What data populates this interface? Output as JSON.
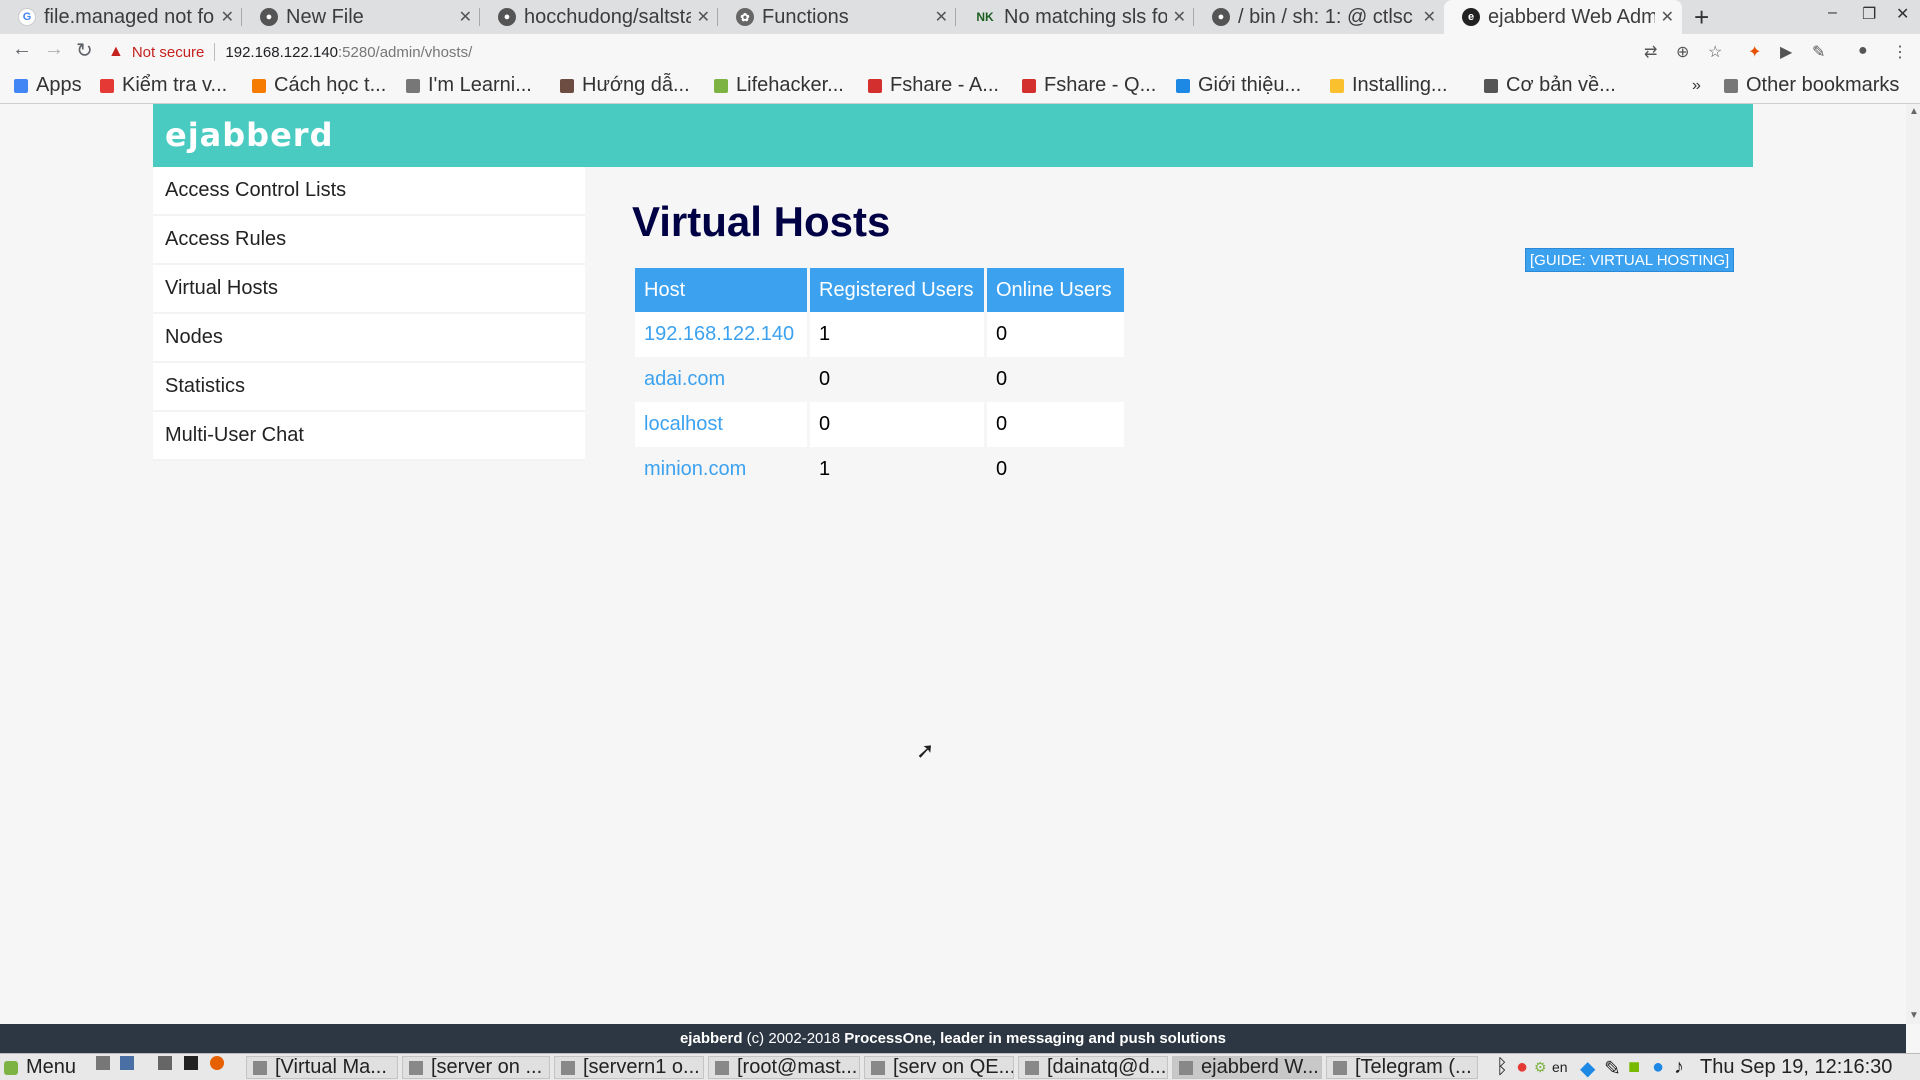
{
  "browser": {
    "tabs": [
      {
        "title": "file.managed not fo",
        "icon": "google-icon"
      },
      {
        "title": "New File",
        "icon": "github-icon"
      },
      {
        "title": "hocchudong/saltsta",
        "icon": "github-icon"
      },
      {
        "title": "Functions",
        "icon": "salt-icon"
      },
      {
        "title": "No matching sls fou",
        "icon": "nk-icon",
        "fav_text": "NK"
      },
      {
        "title": "/ bin / sh: 1: @ ctlsc",
        "icon": "github-icon"
      },
      {
        "title": "ejabberd Web Adm",
        "icon": "ejabberd-icon",
        "active": true
      }
    ],
    "address": {
      "security": "Not secure",
      "host": "192.168.122.140",
      "path": ":5280/admin/vhosts/"
    },
    "bookmarks": [
      {
        "label": "Apps",
        "color": "#4285f4"
      },
      {
        "label": "Kiểm tra v...",
        "color": "#e53935"
      },
      {
        "label": "Cách học t...",
        "color": "#f57c00"
      },
      {
        "label": "I'm Learni...",
        "color": "#777777"
      },
      {
        "label": "Hướng dẫ...",
        "color": "#6d4c41"
      },
      {
        "label": "Lifehacker...",
        "color": "#7cb342"
      },
      {
        "label": "Fshare - A...",
        "color": "#d32f2f"
      },
      {
        "label": "Fshare - Q...",
        "color": "#d32f2f"
      },
      {
        "label": "Giới thiệu...",
        "color": "#1e88e5"
      },
      {
        "label": "Installing...",
        "color": "#fbc02d"
      },
      {
        "label": "Cơ bản về...",
        "color": "#555555"
      }
    ],
    "bookmarks_more": "»",
    "other_bookmarks": "Other bookmarks"
  },
  "page": {
    "logo": "ejabberd",
    "sidebar": [
      "Access Control Lists",
      "Access Rules",
      "Virtual Hosts",
      "Nodes",
      "Statistics",
      "Multi-User Chat"
    ],
    "title": "Virtual Hosts",
    "guide_button": "[GUIDE: VIRTUAL HOSTING]",
    "table": {
      "headers": [
        "Host",
        "Registered Users",
        "Online Users"
      ],
      "rows": [
        {
          "host": "192.168.122.140",
          "registered": "1",
          "online": "0"
        },
        {
          "host": "adai.com",
          "registered": "0",
          "online": "0"
        },
        {
          "host": "localhost",
          "registered": "0",
          "online": "0"
        },
        {
          "host": "minion.com",
          "registered": "1",
          "online": "0"
        }
      ]
    },
    "footer": {
      "brand": "ejabberd",
      "middle": " (c) 2002-2018 ",
      "company": "ProcessOne, leader in messaging and push solutions"
    }
  },
  "taskbar": {
    "menu": "Menu",
    "windows": [
      {
        "label": "[Virtual Ma...",
        "active": false
      },
      {
        "label": "[server on ...",
        "active": false
      },
      {
        "label": "[servern1 o...",
        "active": false
      },
      {
        "label": "[root@mast...",
        "active": false
      },
      {
        "label": "[serv on QE...",
        "active": false
      },
      {
        "label": "[dainatq@d...",
        "active": false
      },
      {
        "label": "ejabberd W...",
        "active": true
      },
      {
        "label": "[Telegram (...",
        "active": false
      }
    ],
    "lang": "en",
    "clock": "Thu Sep 19, 12:16:30 PM"
  },
  "colors": {
    "header": "#49cbc1",
    "accent": "#3ca2f0",
    "title": "#000044",
    "footer": "#2d3743"
  }
}
